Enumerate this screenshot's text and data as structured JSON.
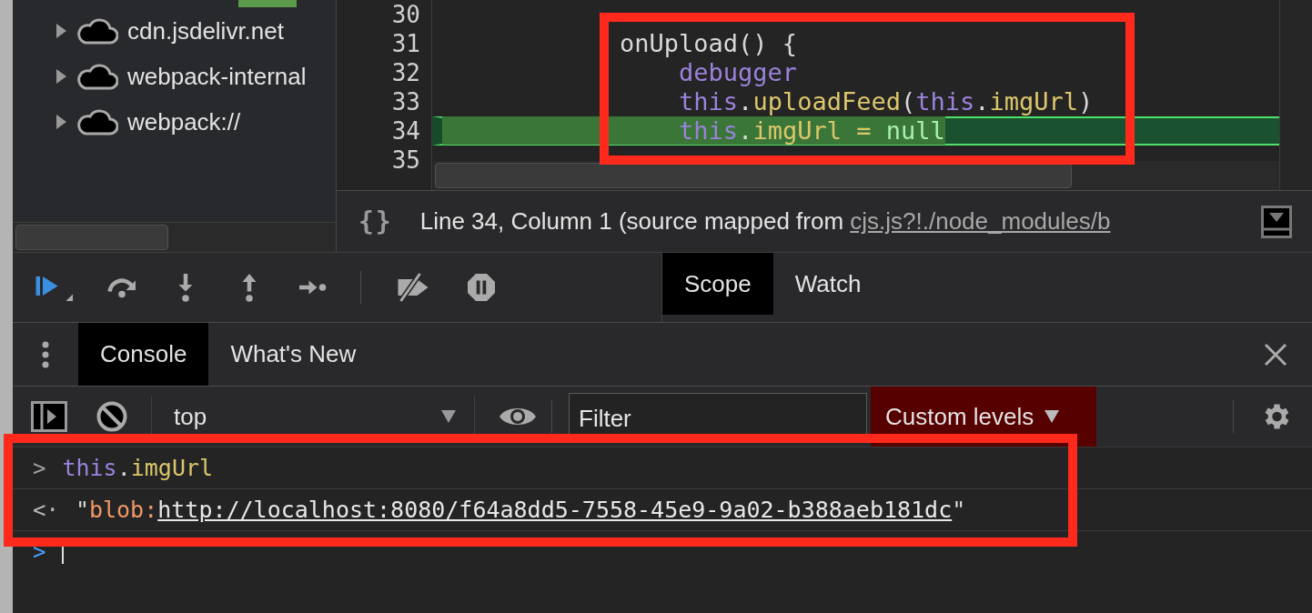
{
  "navigator": {
    "items": [
      {
        "label": "cdn.jsdelivr.net",
        "expanded": false
      },
      {
        "label": "webpack-internal",
        "expanded": false
      },
      {
        "label": "webpack://",
        "expanded": false
      }
    ]
  },
  "editor": {
    "lines": [
      {
        "number": "30",
        "current": false
      },
      {
        "number": "31",
        "current": false,
        "tokens": [
          {
            "kind": "plain",
            "text": "            onUpload() {"
          }
        ]
      },
      {
        "number": "32",
        "current": false,
        "tokens": [
          {
            "kind": "keyword",
            "text": "                debugger"
          }
        ]
      },
      {
        "number": "33",
        "current": false,
        "tokens": [
          {
            "kind": "keyword",
            "text": "                this"
          },
          {
            "kind": "plain",
            "text": "."
          },
          {
            "kind": "property",
            "text": "uploadFeed"
          },
          {
            "kind": "plain",
            "text": "("
          },
          {
            "kind": "keyword",
            "text": "this"
          },
          {
            "kind": "plain",
            "text": "."
          },
          {
            "kind": "property",
            "text": "imgUrl"
          },
          {
            "kind": "plain",
            "text": ")"
          }
        ]
      },
      {
        "number": "34",
        "current": true,
        "tokens": [
          {
            "kind": "keyword",
            "text": "                this"
          },
          {
            "kind": "plain",
            "text": "."
          },
          {
            "kind": "property",
            "text": "imgUrl = "
          },
          {
            "kind": "literal",
            "text": "null"
          }
        ]
      },
      {
        "number": "35",
        "current": false
      }
    ]
  },
  "status_bar": {
    "format_button": "{}",
    "text": "Line 34, Column 1  (source mapped from ",
    "link": "cjs.js?!./node_modules/b"
  },
  "sidebar_tabs": [
    {
      "label": "Scope",
      "selected": true
    },
    {
      "label": "Watch",
      "selected": false
    }
  ],
  "drawer_tabs": [
    {
      "label": "Console",
      "selected": true
    },
    {
      "label": "What's New",
      "selected": false
    }
  ],
  "console_toolbar": {
    "context": "top",
    "filter_placeholder": "Filter",
    "levels": "Custom levels"
  },
  "messages": [
    {
      "kind": "input",
      "marker": ">",
      "tokens": [
        {
          "kind": "keyword",
          "text": "this"
        },
        {
          "kind": "plain",
          "text": "."
        },
        {
          "kind": "property",
          "text": "imgUrl"
        }
      ]
    },
    {
      "kind": "result",
      "marker": "<·",
      "tokens": [
        {
          "kind": "plain",
          "text": "\""
        },
        {
          "kind": "string",
          "text": "blob:"
        },
        {
          "kind": "link",
          "text": "http://localhost:8080/f64a8dd5-7558-45e9-9a02-b388aeb181dc"
        },
        {
          "kind": "plain",
          "text": "\""
        }
      ]
    }
  ],
  "prompt": {
    "marker": ">"
  }
}
